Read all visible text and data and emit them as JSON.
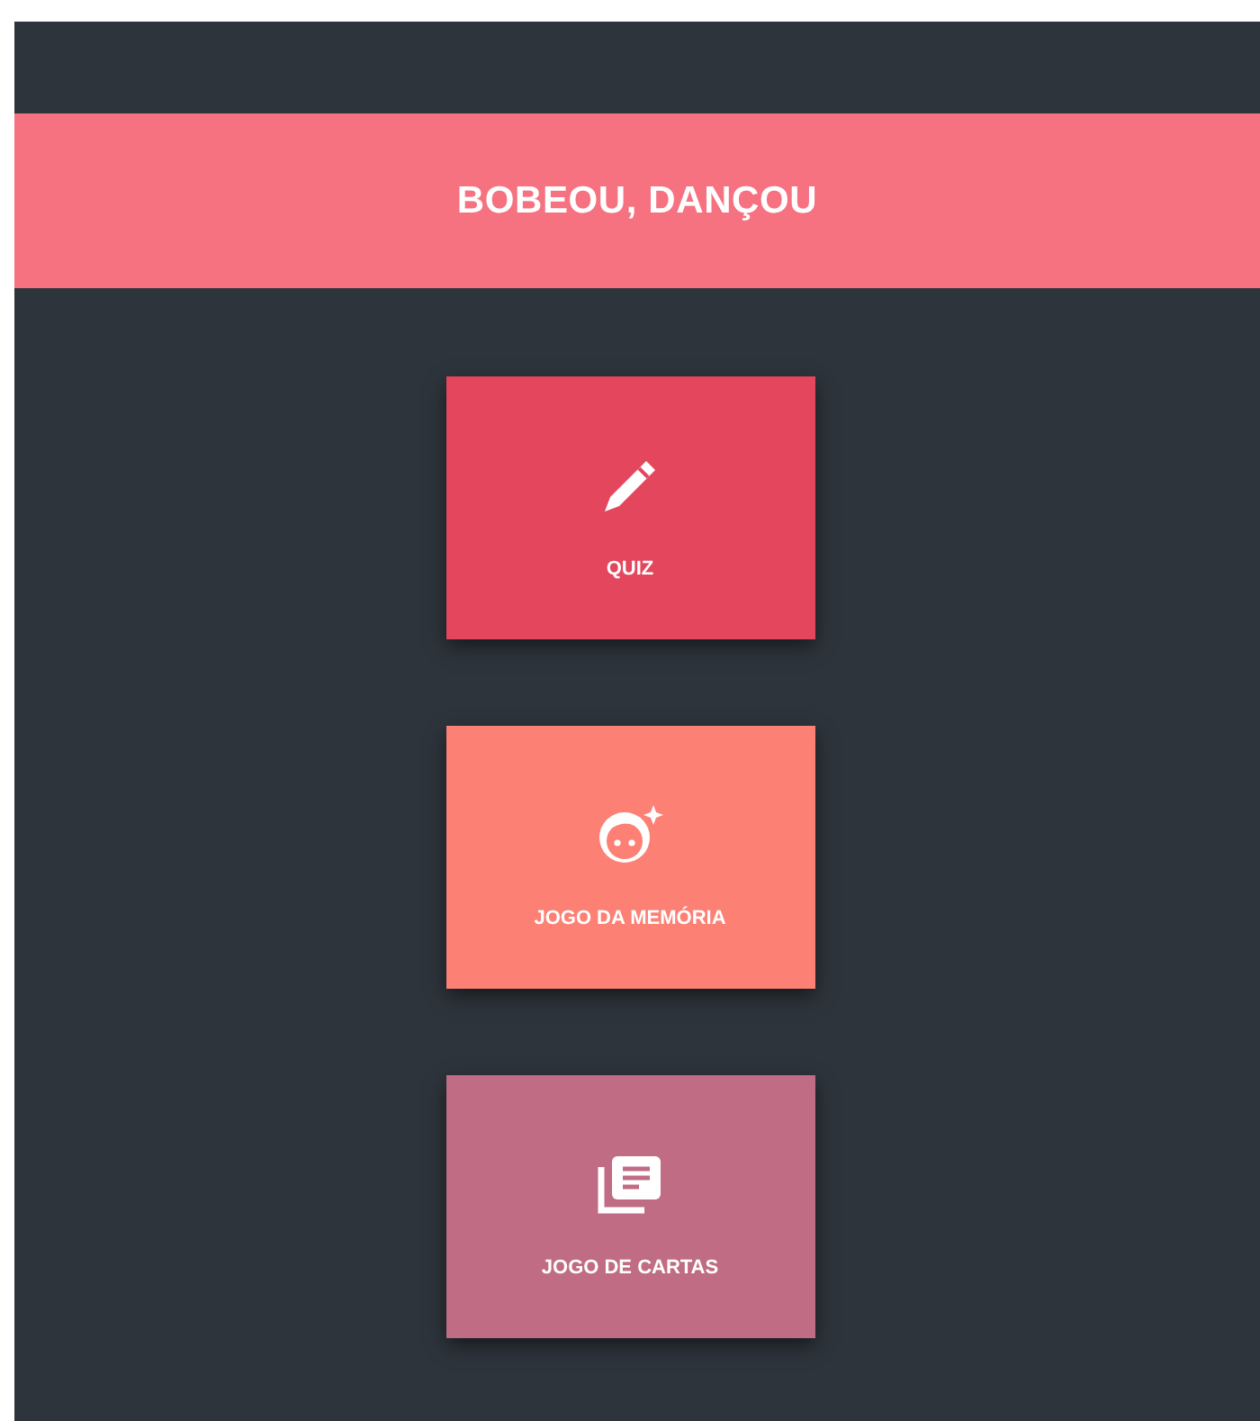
{
  "header": {
    "title": "BOBEOU, DANÇOU"
  },
  "menu": [
    {
      "kind": "pencil",
      "label": "QUIZ",
      "color": "#e4475d"
    },
    {
      "kind": "face",
      "label": "JOGO DA MEMÓRIA",
      "color": "#fd8075"
    },
    {
      "kind": "cards",
      "label": "JOGO DE CARTAS",
      "color": "#c06c84"
    }
  ]
}
